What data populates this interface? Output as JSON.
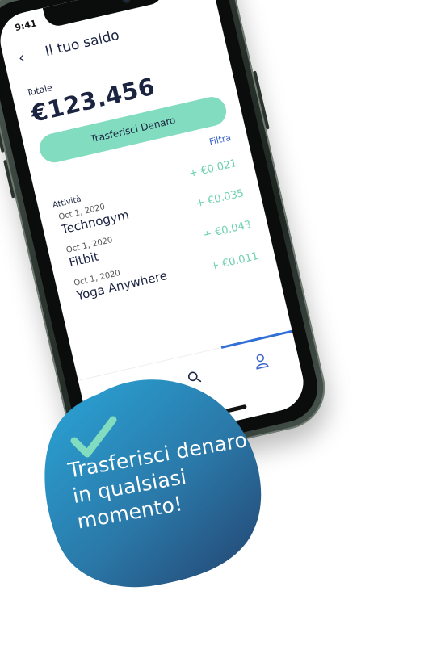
{
  "status_bar": {
    "time": "9:41"
  },
  "nav": {
    "title": "Il tuo saldo"
  },
  "balance": {
    "label": "Totale",
    "amount": "€123.456"
  },
  "transfer_button": {
    "label": "Trasferisci Denaro"
  },
  "filter": {
    "label": "Filtra"
  },
  "activity": {
    "label": "Attività",
    "items": [
      {
        "date": "Oct 1, 2020",
        "name": "Technogym",
        "amount": "+ €0.021"
      },
      {
        "date": "Oct 1, 2020",
        "name": "Fitbit",
        "amount": "+ €0.035"
      },
      {
        "date": "Oct 1, 2020",
        "name": "Yoga Anywhere",
        "amount": "+ €0.043"
      },
      {
        "date": "",
        "name": "",
        "amount": "+ €0.011"
      }
    ]
  },
  "promo": {
    "lines": [
      "Trasferisci denaro",
      "in qualsiasi",
      "momento!"
    ]
  },
  "colors": {
    "accent_green": "#82dcbf",
    "amount_green": "#6ed1af",
    "link_blue": "#3a64c8",
    "navy_text": "#1a2340",
    "badge_start": "#2aa6d8",
    "badge_end": "#24426e",
    "check": "#82dcbf"
  },
  "icons": [
    "back-arrow-icon",
    "search-icon",
    "profile-icon",
    "check-icon"
  ]
}
